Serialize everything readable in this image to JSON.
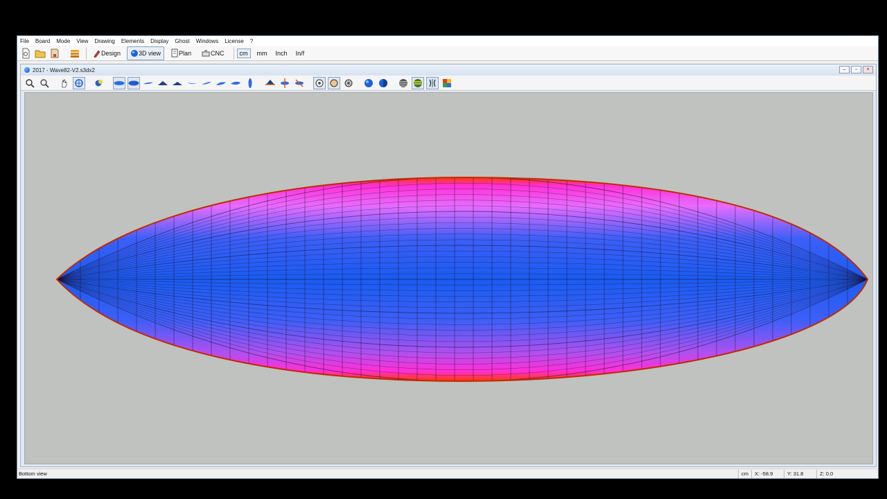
{
  "menu": [
    "File",
    "Board",
    "Mode",
    "View",
    "Drawing",
    "Elements",
    "Display",
    "Ghost",
    "Windows",
    "License",
    "?"
  ],
  "modebar": {
    "modes": [
      {
        "label": "Design",
        "icon": "pencil-icon",
        "active": false
      },
      {
        "label": "3D view",
        "icon": "globe-icon",
        "active": true
      },
      {
        "label": "Plan",
        "icon": "plan-icon",
        "active": false
      },
      {
        "label": "CNC",
        "icon": "cnc-machine-icon",
        "active": false
      }
    ],
    "units": [
      "cm",
      "mm",
      "Inch",
      "In/f"
    ],
    "active_unit": "cm"
  },
  "document": {
    "title": "2017 - Wave82-V2.s3dx2",
    "controls": [
      "minimize",
      "restore",
      "close"
    ]
  },
  "viewbar_icons": [
    "zoom-icon",
    "zoom-window-icon",
    "pan-hand-icon",
    "rotate-icon",
    "light-icon",
    "top-view-icon",
    "bottom-view-icon",
    "side-view-icon",
    "front-view-icon",
    "back-view-icon",
    "rocker-view-icon",
    "perspective-left-icon",
    "perspective-right-icon",
    "tail-view-icon",
    "nose-view-icon",
    "edge-view-icon",
    "axis-x-icon",
    "axis-y-icon",
    "axis-z-icon",
    "shading-smooth-icon",
    "shading-flat-icon",
    "wireframe-icon",
    "sphere-blue-icon",
    "sphere-half-icon",
    "sphere-striped-icon",
    "sphere-zebra-icon",
    "mirror-icon",
    "colors-icon"
  ],
  "board": {
    "colors": {
      "center": "#1a5cf0",
      "rail": "#ff2fd6",
      "edge": "#ff3a00",
      "background": "#bfc2bf"
    }
  },
  "status": {
    "view": "Bottom view",
    "unit": "cm",
    "x": "X: -58.9",
    "y": "Y: 31.8",
    "z": "Z: 0.0"
  }
}
